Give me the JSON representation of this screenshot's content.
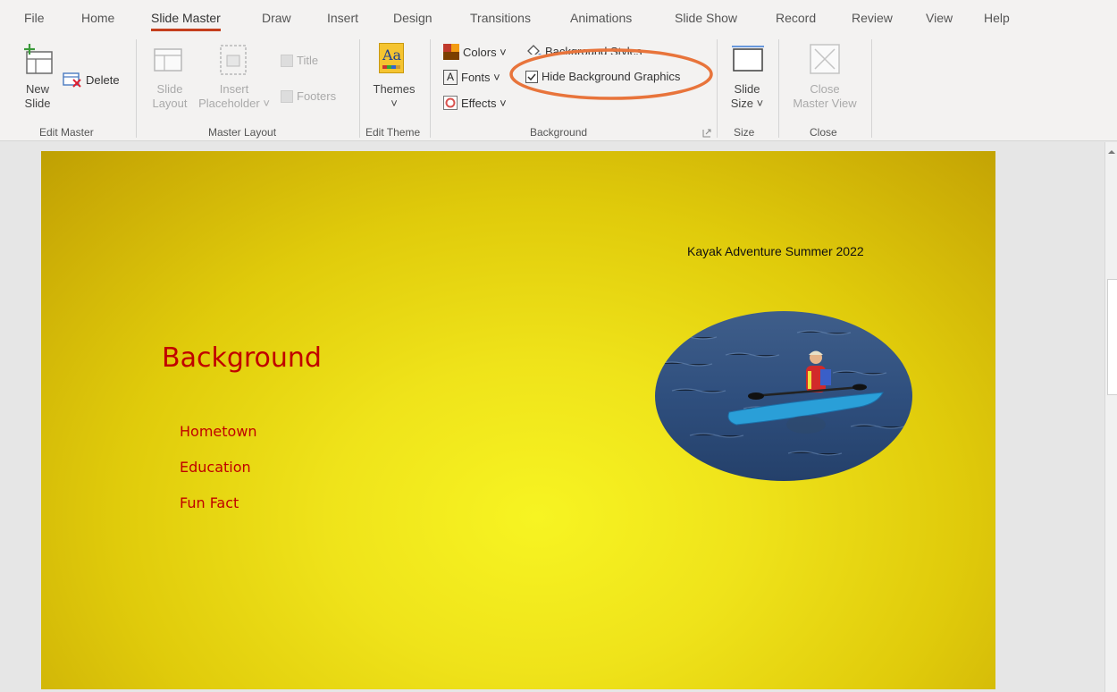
{
  "menu": {
    "tabs": [
      {
        "label": "File"
      },
      {
        "label": "Home"
      },
      {
        "label": "Slide Master"
      },
      {
        "label": "Draw"
      },
      {
        "label": "Insert"
      },
      {
        "label": "Design"
      },
      {
        "label": "Transitions"
      },
      {
        "label": "Animations"
      },
      {
        "label": "Slide Show"
      },
      {
        "label": "Record"
      },
      {
        "label": "Review"
      },
      {
        "label": "View"
      },
      {
        "label": "Help"
      }
    ],
    "active": "Slide Master"
  },
  "ribbon": {
    "edit_master": {
      "new_slide_line1": "New",
      "new_slide_line2": "Slide",
      "delete": "Delete",
      "label": "Edit Master"
    },
    "master_layout": {
      "slide_layout_line1": "Slide",
      "slide_layout_line2": "Layout",
      "insert_placeholder_line1": "Insert",
      "insert_placeholder_line2": "Placeholder ˅",
      "title": "Title",
      "footers": "Footers",
      "label": "Master Layout"
    },
    "edit_theme": {
      "themes": "Themes",
      "themes_glyph": "Aa",
      "chevron": "˅",
      "label": "Edit Theme"
    },
    "background": {
      "colors": "Colors ˅",
      "fonts": "Fonts ˅",
      "effects": "Effects ˅",
      "background_styles": "Background Styles",
      "hide_background_graphics": "Hide Background Graphics",
      "hide_background_checked": true,
      "label": "Background"
    },
    "size": {
      "slide_size_line1": "Slide",
      "slide_size_line2": "Size ˅",
      "label": "Size"
    },
    "close": {
      "close_line1": "Close",
      "close_line2": "Master View",
      "label": "Close"
    }
  },
  "slide": {
    "header_text": "Kayak Adventure Summer 2022",
    "title": "Background",
    "bullets": [
      "Hometown",
      "Education",
      "Fun Fact"
    ]
  },
  "colors": {
    "accent_tab": "#c43e1c",
    "highlight_circle": "#e8743b",
    "slide_text_red": "#c00000"
  }
}
